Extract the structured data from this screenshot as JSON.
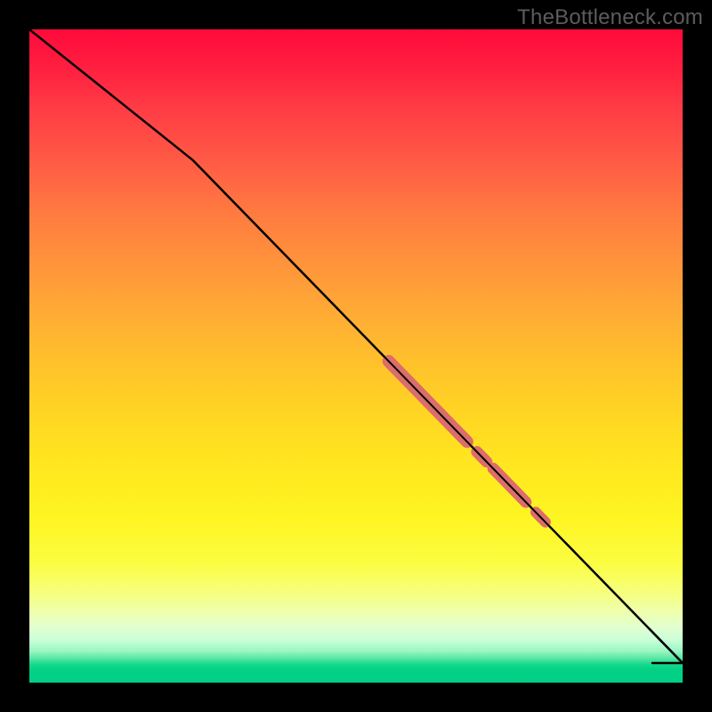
{
  "attribution": "TheBottleneck.com",
  "colors": {
    "background": "#000000",
    "line": "#000000",
    "marker": "#db6d6a",
    "gradient_top": "#ff0a3a",
    "gradient_bottom": "#00cf85"
  },
  "chart_data": {
    "type": "line",
    "xlabel": "",
    "ylabel": "",
    "xlim": [
      0,
      100
    ],
    "ylim": [
      0,
      100
    ],
    "grid": false,
    "legend": false,
    "series": [
      {
        "name": "curve",
        "x": [
          0,
          25,
          100,
          100
        ],
        "values": [
          100,
          80,
          3,
          3
        ]
      }
    ],
    "markers": {
      "shape": "pill-along-line",
      "segments": [
        {
          "x_start": 55,
          "x_end": 67,
          "y_start": 49.2,
          "y_end": 36.9,
          "thickness": 12
        },
        {
          "x_start": 68.5,
          "x_end": 70,
          "y_start": 35.3,
          "y_end": 33.8,
          "thickness": 12
        },
        {
          "x_start": 71,
          "x_end": 76,
          "y_start": 32.8,
          "y_end": 27.6,
          "thickness": 12
        },
        {
          "x_start": 77.5,
          "x_end": 79,
          "y_start": 26.1,
          "y_end": 24.5,
          "thickness": 12
        }
      ]
    },
    "annotations": [
      {
        "text": "TheBottleneck.com",
        "position": "top-right"
      }
    ]
  }
}
